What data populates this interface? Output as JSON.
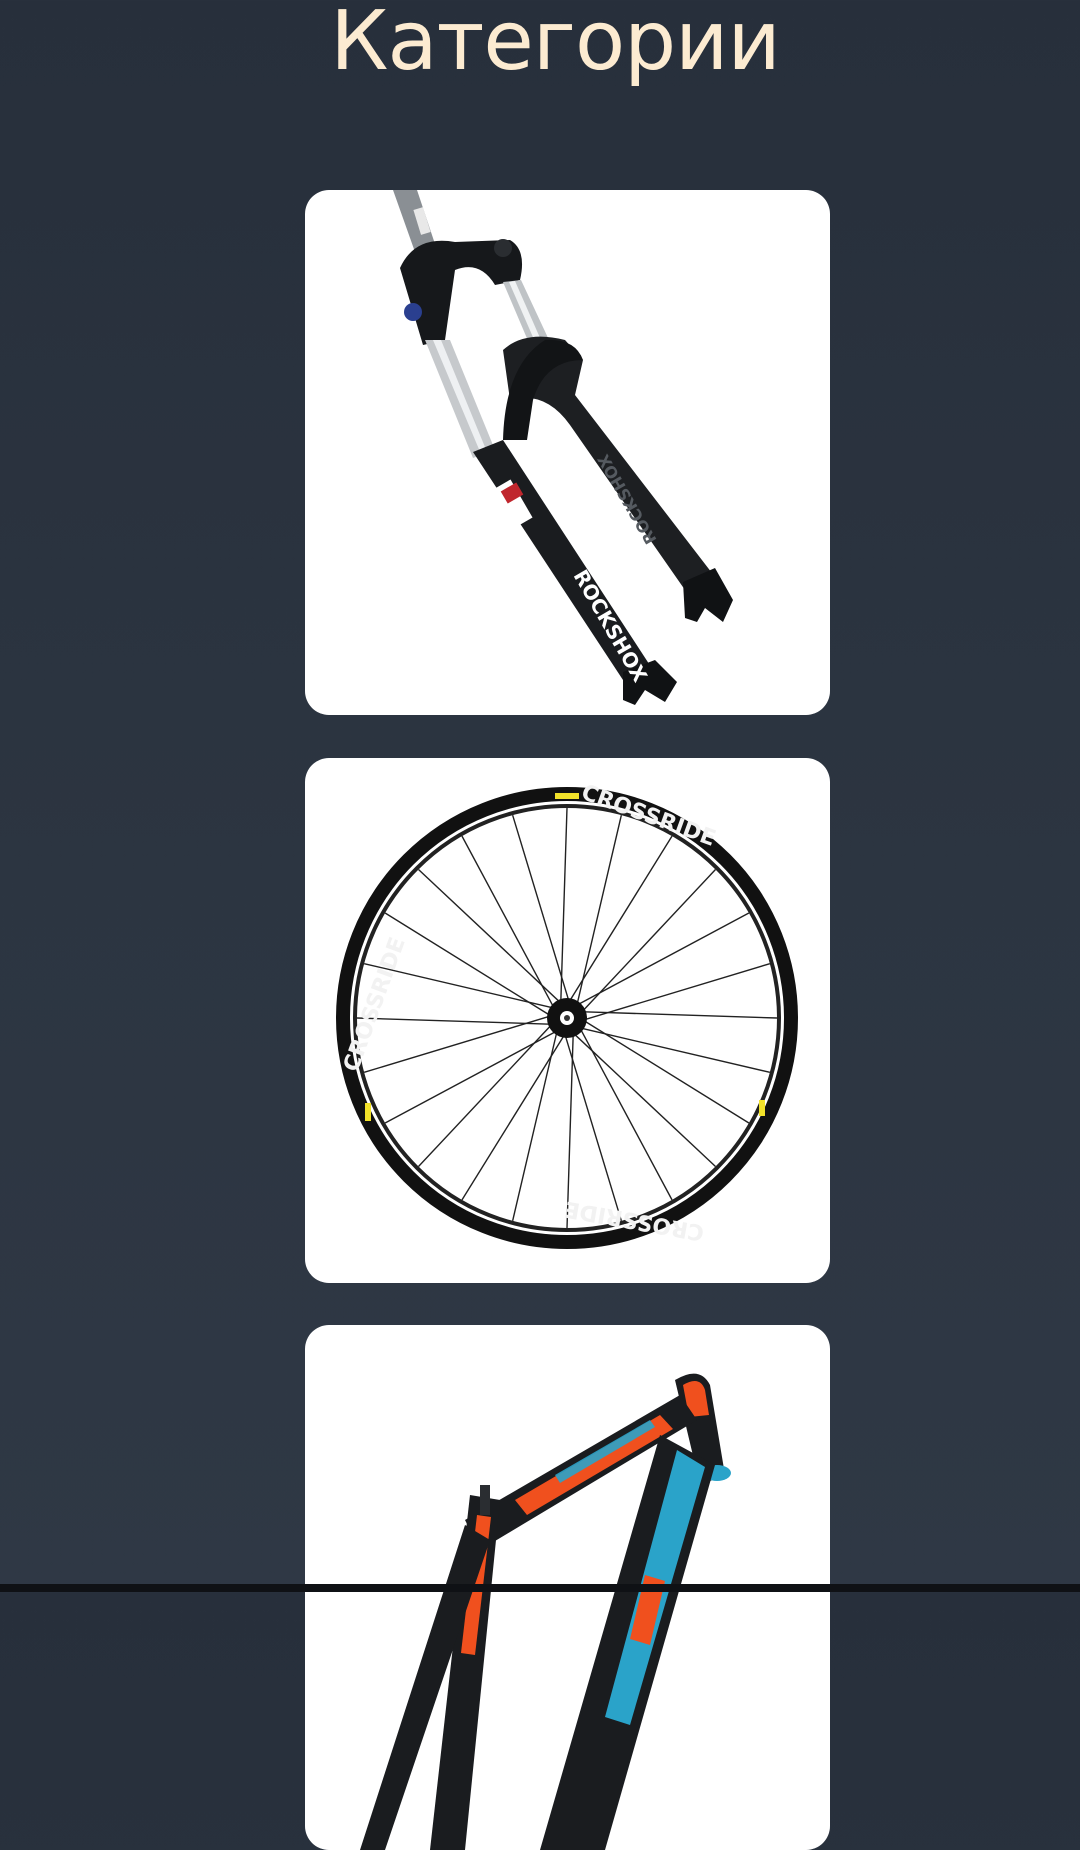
{
  "page": {
    "title": "Категории"
  },
  "categories": [
    {
      "image": "suspension-fork",
      "brand": "ROCKSHOX"
    },
    {
      "image": "bicycle-wheel",
      "brand": "CROSSRIDE"
    },
    {
      "image": "bicycle-frame"
    }
  ],
  "colors": {
    "background": "#2b3440",
    "title": "#fcebd1",
    "card": "#ffffff",
    "frame_orange": "#f0501e",
    "frame_blue": "#2aa3c9"
  }
}
